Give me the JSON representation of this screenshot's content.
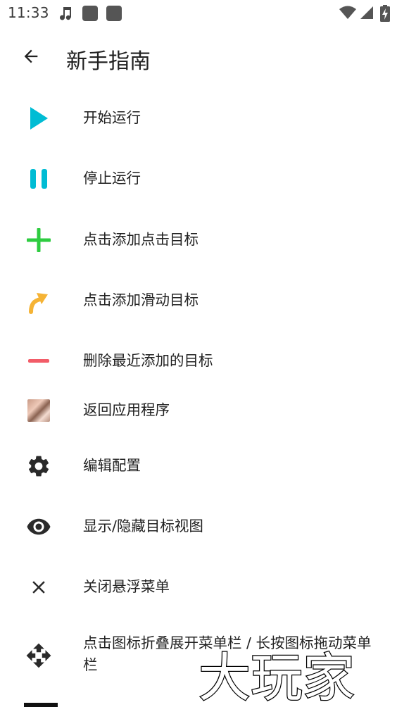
{
  "status_bar": {
    "time": "11:33",
    "left_icons": [
      "music-note-icon",
      "notification-square-icon",
      "notification-square-icon"
    ],
    "right_icons": [
      "wifi-icon",
      "cell-signal-icon",
      "battery-charging-icon"
    ]
  },
  "app_bar": {
    "back_icon": "arrow-back-icon",
    "title": "新手指南"
  },
  "colors": {
    "play": "#00BCD4",
    "pause": "#00BCD4",
    "add": "#2ECC40",
    "swipe": "#F5B335",
    "remove": "#F25C68",
    "dark_icon": "#2a2a2a"
  },
  "items": [
    {
      "icon": "play-icon",
      "label": "开始运行"
    },
    {
      "icon": "pause-icon",
      "label": "停止运行"
    },
    {
      "icon": "plus-icon",
      "label": "点击添加点击目标"
    },
    {
      "icon": "swipe-arrow-icon",
      "label": "点击添加滑动目标"
    },
    {
      "icon": "minus-icon",
      "label": "删除最近添加的目标"
    },
    {
      "icon": "app-thumbnail-icon",
      "label": "返回应用程序"
    },
    {
      "icon": "gear-icon",
      "label": "编辑配置"
    },
    {
      "icon": "eye-icon",
      "label": "显示/隐藏目标视图"
    },
    {
      "icon": "close-icon",
      "label": "关闭悬浮菜单"
    },
    {
      "icon": "move-icon",
      "label": "点击图标折叠展开菜单栏 / 长按图标拖动菜单栏"
    }
  ],
  "watermark": {
    "text": "大玩家"
  }
}
